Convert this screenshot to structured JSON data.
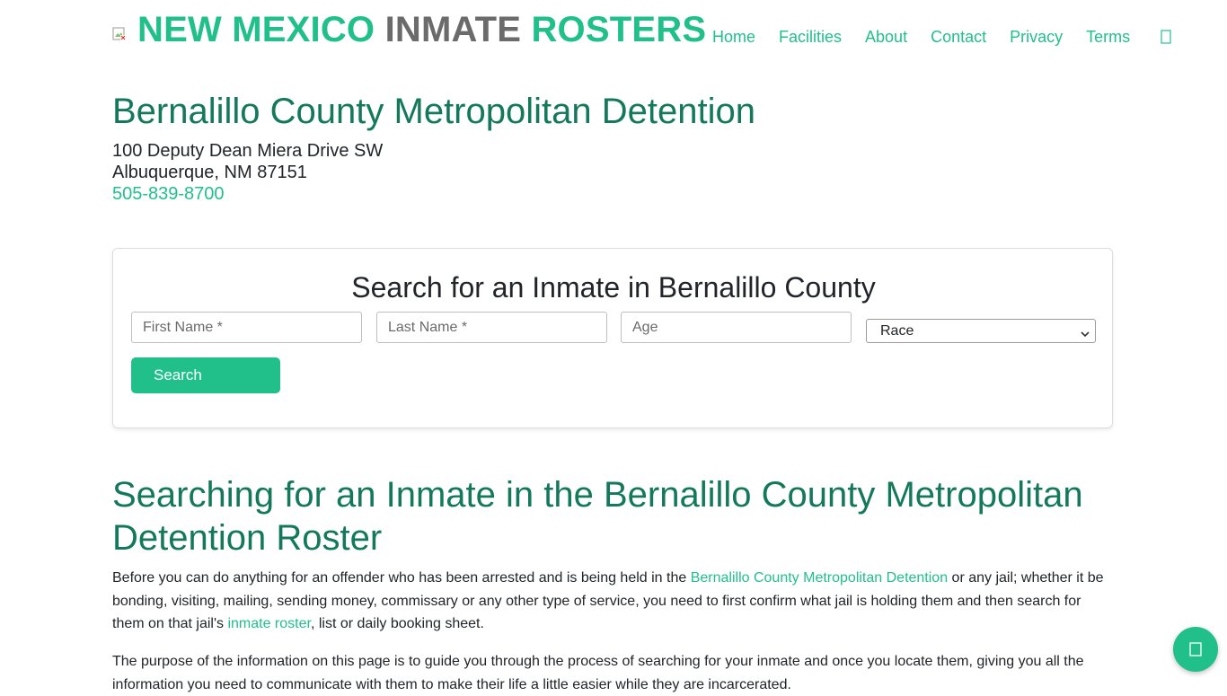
{
  "header": {
    "brand_part1": "NEW MEXICO",
    "brand_part2": "INMATE",
    "brand_part3": "ROSTERS",
    "nav": [
      "Home",
      "Facilities",
      "About",
      "Contact",
      "Privacy",
      "Terms"
    ],
    "icons": {
      "logo": "broken-image-icon",
      "search": "search-icon",
      "chat": "chat-icon"
    }
  },
  "facility": {
    "title": "Bernalillo County Metropolitan Detention",
    "address_line1": "100 Deputy Dean Miera Drive SW",
    "address_line2": "Albuquerque, NM 87151",
    "phone": "505-839-8700"
  },
  "search": {
    "title": "Search for an Inmate in Bernalillo County",
    "first_name_placeholder": "First Name *",
    "last_name_placeholder": "Last Name *",
    "age_placeholder": "Age",
    "race_selected": "Race",
    "button_label": "Search"
  },
  "article": {
    "heading": "Searching for an Inmate in the Bernalillo County Metropolitan Detention Roster",
    "p1_before": "Before you can do anything for an offender who has been arrested and is being held in the ",
    "p1_link1": "Bernalillo County Metropolitan Detention",
    "p1_middle": " or any jail; whether it be bonding, visiting, mailing, sending money, commissary or any other type of service, you need to first confirm what jail is holding them and then search for them on that jail's ",
    "p1_link2": "inmate roster",
    "p1_after": ", list or daily booking sheet.",
    "p2": "The purpose of the information on this page is to guide you through the process of searching for your inmate and once you locate them, giving you all the information you need to communicate with them to make their life a little easier while they are incarcerated."
  },
  "colors": {
    "accent": "#21c08b",
    "heading": "#14795b",
    "brand_gray": "#6b6b6b"
  }
}
